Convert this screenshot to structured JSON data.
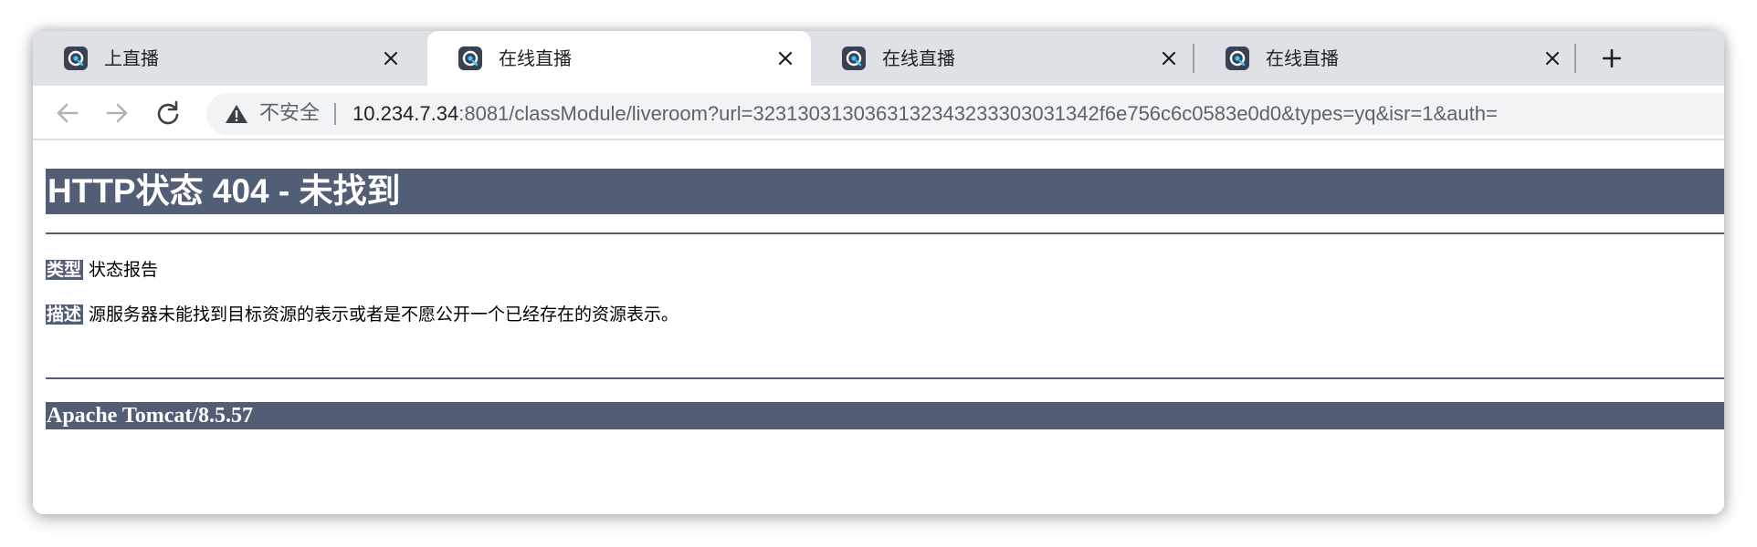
{
  "browser": {
    "tabs": [
      {
        "title": "上直播",
        "active": false,
        "favicon": "app-favicon"
      },
      {
        "title": "在线直播",
        "active": true,
        "favicon": "app-favicon"
      },
      {
        "title": "在线直播",
        "active": false,
        "favicon": "app-favicon"
      },
      {
        "title": "在线直播",
        "active": false,
        "favicon": "app-favicon"
      }
    ],
    "new_tab_icon": "plus-icon",
    "nav": {
      "back_icon": "arrow-left-icon",
      "forward_icon": "arrow-right-icon",
      "reload_icon": "reload-icon"
    },
    "omnibox": {
      "security_icon": "warning-triangle-icon",
      "security_label": "不安全",
      "url_host": "10.234.7.34",
      "url_rest": ":8081/classModule/liveroom?url=3231303130363132343233303031342f6e756c6c0583e0d0&types=yq&isr=1&auth="
    }
  },
  "page": {
    "title": "HTTP状态 404 - 未找到",
    "rows": [
      {
        "key": "类型",
        "value": "状态报告"
      },
      {
        "key": "描述",
        "value": "源服务器未能找到目标资源的表示或者是不愿公开一个已经存在的资源表示。"
      }
    ],
    "server": "Apache Tomcat/8.5.57"
  },
  "colors": {
    "tomcat_banner": "#525d76",
    "tabstrip_bg": "#dee1e6",
    "omnibox_bg": "#f1f3f4",
    "favicon_bg": "#3a4152"
  }
}
